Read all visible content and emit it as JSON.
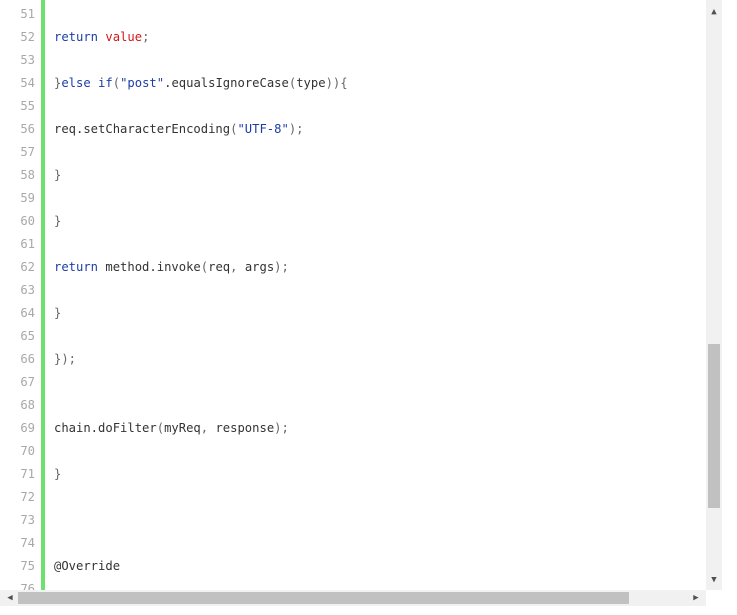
{
  "editor": {
    "gutter_color": "#6ee06e",
    "lines": [
      {
        "n": "51",
        "tokens": []
      },
      {
        "n": "52",
        "tokens": [
          {
            "t": "return",
            "c": "kw"
          },
          {
            "t": " ",
            "c": "txt"
          },
          {
            "t": "value",
            "c": "var"
          },
          {
            "t": ";",
            "c": "punc"
          }
        ]
      },
      {
        "n": "53",
        "tokens": []
      },
      {
        "n": "54",
        "tokens": [
          {
            "t": "}",
            "c": "punc"
          },
          {
            "t": "else",
            "c": "kw"
          },
          {
            "t": " ",
            "c": "txt"
          },
          {
            "t": "if",
            "c": "kw"
          },
          {
            "t": "(",
            "c": "punc"
          },
          {
            "t": "\"post\"",
            "c": "str"
          },
          {
            "t": ".equalsIgnoreCase",
            "c": "txt"
          },
          {
            "t": "(",
            "c": "punc"
          },
          {
            "t": "type",
            "c": "txt"
          },
          {
            "t": ")){",
            "c": "punc"
          }
        ]
      },
      {
        "n": "55",
        "tokens": []
      },
      {
        "n": "56",
        "tokens": [
          {
            "t": "req.setCharacterEncoding",
            "c": "txt"
          },
          {
            "t": "(",
            "c": "punc"
          },
          {
            "t": "\"UTF-8\"",
            "c": "str"
          },
          {
            "t": ");",
            "c": "punc"
          }
        ]
      },
      {
        "n": "57",
        "tokens": []
      },
      {
        "n": "58",
        "tokens": [
          {
            "t": "}",
            "c": "punc"
          }
        ]
      },
      {
        "n": "59",
        "tokens": []
      },
      {
        "n": "60",
        "tokens": [
          {
            "t": "}",
            "c": "punc"
          }
        ]
      },
      {
        "n": "61",
        "tokens": []
      },
      {
        "n": "62",
        "tokens": [
          {
            "t": "return",
            "c": "kw"
          },
          {
            "t": " method.invoke",
            "c": "txt"
          },
          {
            "t": "(",
            "c": "punc"
          },
          {
            "t": "req",
            "c": "txt"
          },
          {
            "t": ", ",
            "c": "punc"
          },
          {
            "t": "args",
            "c": "txt"
          },
          {
            "t": ");",
            "c": "punc"
          }
        ]
      },
      {
        "n": "63",
        "tokens": []
      },
      {
        "n": "64",
        "tokens": [
          {
            "t": "}",
            "c": "punc"
          }
        ]
      },
      {
        "n": "65",
        "tokens": []
      },
      {
        "n": "66",
        "tokens": [
          {
            "t": "});",
            "c": "punc"
          }
        ]
      },
      {
        "n": "67",
        "tokens": []
      },
      {
        "n": "68",
        "tokens": []
      },
      {
        "n": "69",
        "tokens": [
          {
            "t": "chain.doFilter",
            "c": "txt"
          },
          {
            "t": "(",
            "c": "punc"
          },
          {
            "t": "myReq",
            "c": "txt"
          },
          {
            "t": ", ",
            "c": "punc"
          },
          {
            "t": "response",
            "c": "txt"
          },
          {
            "t": ");",
            "c": "punc"
          }
        ]
      },
      {
        "n": "70",
        "tokens": []
      },
      {
        "n": "71",
        "tokens": [
          {
            "t": "}",
            "c": "punc"
          }
        ]
      },
      {
        "n": "72",
        "tokens": []
      },
      {
        "n": "73",
        "tokens": []
      },
      {
        "n": "74",
        "tokens": []
      },
      {
        "n": "75",
        "tokens": [
          {
            "t": "@Override",
            "c": "txt"
          }
        ]
      },
      {
        "n": "76",
        "tokens": []
      }
    ]
  },
  "scrollbars": {
    "up_arrow_icon": "▲",
    "down_arrow_icon": "▼",
    "left_arrow_icon": "◀",
    "right_arrow_icon": "▶"
  }
}
